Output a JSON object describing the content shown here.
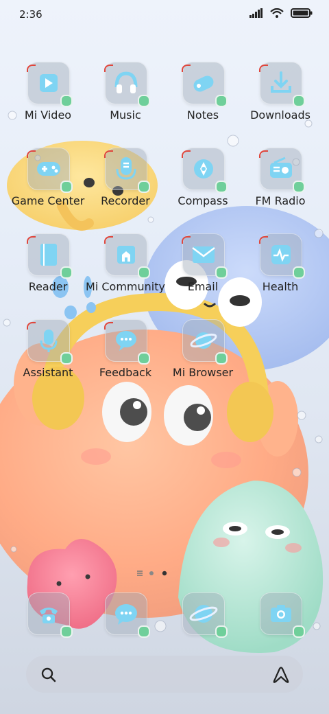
{
  "status": {
    "time": "2:36"
  },
  "apps": [
    {
      "label": "Mi Video",
      "icon": "video-play-icon"
    },
    {
      "label": "Music",
      "icon": "headphones-icon"
    },
    {
      "label": "Notes",
      "icon": "notes-icon"
    },
    {
      "label": "Downloads",
      "icon": "download-icon"
    },
    {
      "label": "Game Center",
      "icon": "gamepad-icon"
    },
    {
      "label": "Recorder",
      "icon": "microphone-icon"
    },
    {
      "label": "Compass",
      "icon": "compass-icon"
    },
    {
      "label": "FM Radio",
      "icon": "radio-icon"
    },
    {
      "label": "Reader",
      "icon": "book-icon"
    },
    {
      "label": "Mi Community",
      "icon": "community-house-icon"
    },
    {
      "label": "Email",
      "icon": "envelope-icon"
    },
    {
      "label": "Health",
      "icon": "heartbeat-icon"
    },
    {
      "label": "Assistant",
      "icon": "assistant-icon"
    },
    {
      "label": "Feedback",
      "icon": "chat-bubble-icon"
    },
    {
      "label": "Mi Browser",
      "icon": "planet-icon"
    }
  ],
  "dock": [
    {
      "icon": "phone-icon"
    },
    {
      "icon": "messages-icon"
    },
    {
      "icon": "browser-planet-icon"
    },
    {
      "icon": "camera-icon"
    }
  ],
  "colors": {
    "icon_accent": "#7fd4f3",
    "badge_red": "#e0463c",
    "badge_green": "#6fcf9a"
  }
}
